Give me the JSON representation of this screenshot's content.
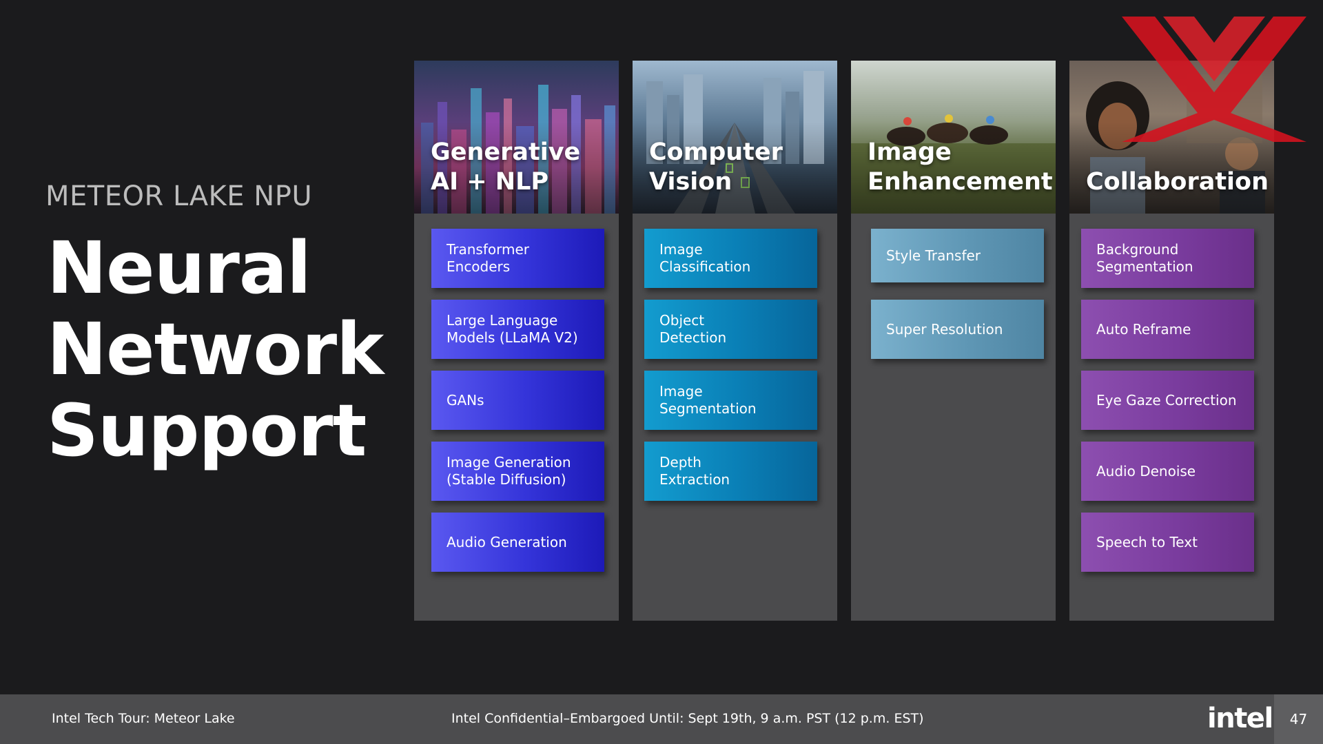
{
  "slide": {
    "eyebrow": "METEOR LAKE NPU",
    "headline": [
      "Neural",
      "Network",
      "Support"
    ]
  },
  "columns": [
    {
      "title": [
        "Generative",
        "AI + NLP"
      ],
      "items": [
        [
          "Transformer",
          "Encoders"
        ],
        [
          "Large Language",
          "Models (LLaMA V2)"
        ],
        [
          "GANs"
        ],
        [
          "Image Generation",
          "(Stable Diffusion)"
        ],
        [
          "Audio Generation"
        ]
      ]
    },
    {
      "title": [
        "Computer",
        "Vision"
      ],
      "items": [
        [
          "Image",
          "Classification"
        ],
        [
          "Object",
          "Detection"
        ],
        [
          "Image",
          "Segmentation"
        ],
        [
          "Depth",
          "Extraction"
        ]
      ]
    },
    {
      "title": [
        "Image",
        "Enhancement"
      ],
      "items": [
        [
          "Style Transfer"
        ],
        [
          "Super Resolution"
        ]
      ]
    },
    {
      "title": [
        "Collaboration"
      ],
      "items": [
        [
          "Background",
          "Segmentation"
        ],
        [
          "Auto Reframe"
        ],
        [
          "Eye Gaze Correction"
        ],
        [
          "Audio Denoise"
        ],
        [
          "Speech to Text"
        ]
      ]
    }
  ],
  "footer": {
    "left": "Intel Tech Tour: Meteor Lake",
    "center": "Intel Confidential–Embargoed Until: Sept 19th, 9 a.m. PST (12 p.m. EST)",
    "logo": "intel.",
    "page": "47"
  },
  "colors": {
    "background": "#1b1b1d",
    "column": "#4b4b4d",
    "gen_ai": "#3434d9",
    "computer_vision": "#0a7fb6",
    "image_enhancement": "#5f97b5",
    "collaboration": "#7a3c9e",
    "watermark": "#d3131f",
    "footer": "#4c4c4e"
  }
}
